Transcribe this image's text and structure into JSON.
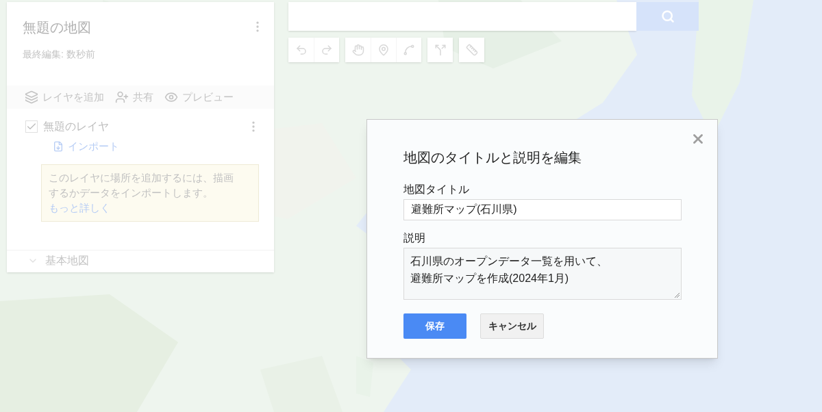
{
  "map": {
    "title": "無題の地図",
    "last_edited": "最終編集: 数秒前",
    "actions": [
      {
        "kind": "add-layer",
        "label": "レイヤを追加"
      },
      {
        "kind": "share",
        "label": "共有"
      },
      {
        "kind": "preview",
        "label": "プレビュー"
      }
    ],
    "layers": [
      {
        "name": "無題のレイヤ",
        "checked": true,
        "import_label": "インポート",
        "hint": "このレイヤに場所を追加するには、描画するかデータをインポートします。",
        "hint_link": "もっと詳しく"
      }
    ],
    "base_map": "基本地図"
  },
  "tool_groups": [
    [
      {
        "kind": "undo"
      },
      {
        "kind": "redo"
      }
    ],
    [
      {
        "kind": "hand"
      },
      {
        "kind": "marker"
      },
      {
        "kind": "line"
      }
    ],
    [
      {
        "kind": "directions"
      }
    ],
    [
      {
        "kind": "ruler"
      }
    ]
  ],
  "dialog": {
    "title": "地図のタイトルと説明を編集",
    "fields": [
      {
        "kind": "input",
        "label": "地図タイトル",
        "value": "避難所マップ(石川県)"
      },
      {
        "kind": "textarea",
        "label": "説明",
        "lines": [
          "石川県のオープンデータ一覧を用いて、",
          "避難所マップを作成(2024年1月)"
        ]
      }
    ],
    "buttons": [
      {
        "kind": "primary",
        "label": "保存"
      },
      {
        "kind": "secondary",
        "label": "キャンセル"
      }
    ]
  }
}
